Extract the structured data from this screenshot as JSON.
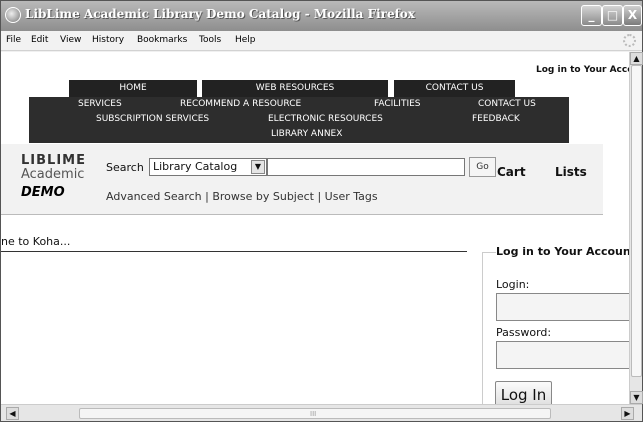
{
  "window": {
    "title": "LibLime Academic Library Demo Catalog - Mozilla Firefox",
    "buttons": [
      "_",
      "□",
      "X"
    ]
  },
  "menu": [
    "File",
    "Edit",
    "View",
    "History",
    "Bookmarks",
    "Tools",
    "Help"
  ],
  "top_login_link": "Log in to Your Acco",
  "nav_row1": [
    "HOME",
    "WEB RESOURCES",
    "CONTACT US"
  ],
  "nav_row2": [
    "SERVICES",
    "RECOMMEND A RESOURCE",
    "FACILITIES",
    "CONTACT US"
  ],
  "nav_row3": [
    "SUBSCRIPTION SERVICES",
    "ELECTRONIC RESOURCES",
    "FEEDBACK",
    "LIBRARY ANNEX"
  ],
  "logo": {
    "line1": "LIBLIME",
    "line2": "Academic",
    "line3": "DEMO"
  },
  "search": {
    "label": "Search",
    "select_value": "Library Catalog",
    "input_value": "",
    "go_label": "Go"
  },
  "header_links": {
    "cart": "Cart",
    "lists": "Lists"
  },
  "sub_links": "Advanced Search | Browse by Subject | User Tags",
  "welcome_text": "ne to Koha...",
  "login_box": {
    "title": "Log in to Your Account:",
    "login_label": "Login:",
    "password_label": "Password:",
    "button_label": "Log In"
  },
  "scroll_grip": "III"
}
